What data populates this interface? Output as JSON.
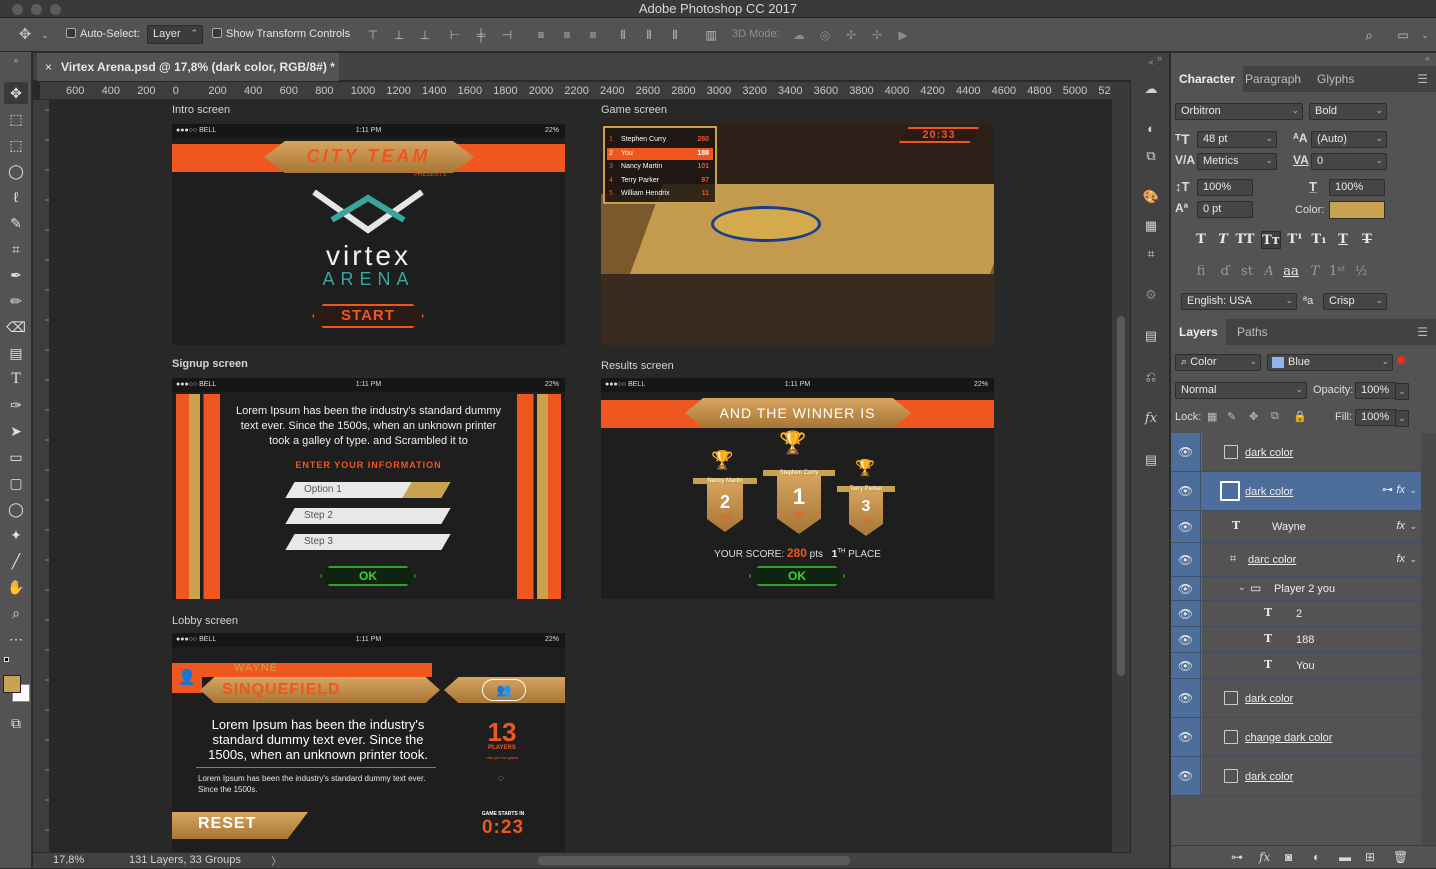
{
  "app": {
    "title": "Adobe Photoshop CC 2017"
  },
  "options": {
    "auto_select_label": "Auto-Select:",
    "auto_select_value": "Layer",
    "transform_controls_label": "Show Transform Controls",
    "mode_3d_label": "3D Mode:"
  },
  "document": {
    "tab_title": "Virtex Arena.psd @ 17,8% (dark color, RGB/8#) *",
    "ruler_ticks": [
      "600",
      "400",
      "200",
      "0",
      "200",
      "400",
      "600",
      "800",
      "1000",
      "1200",
      "1400",
      "1600",
      "1800",
      "2000",
      "2200",
      "2400",
      "2600",
      "2800",
      "3000",
      "3200",
      "3400",
      "3600",
      "3800",
      "4000",
      "4200",
      "4400",
      "4600",
      "4800",
      "5000",
      "52"
    ],
    "zoom": "17,8%",
    "info": "131 Layers, 33 Groups"
  },
  "artboards": {
    "intro": {
      "label": "Intro screen",
      "status_carrier": "●●●○○ BELL",
      "status_time": "1:11 PM",
      "status_battery": "22%",
      "banner": "CITY TEAM",
      "presents": "PRESENTS",
      "logo_line1": "virtex",
      "logo_line2": "ARENA",
      "start": "START"
    },
    "game": {
      "label": "Game screen",
      "timer": "20:33",
      "leaderboard": [
        {
          "rank": "1",
          "name": "Stephen Curry",
          "score": "280"
        },
        {
          "rank": "2",
          "name": "You",
          "score": "188"
        },
        {
          "rank": "3",
          "name": "Nancy Martin",
          "score": "101"
        },
        {
          "rank": "4",
          "name": "Terry Parker",
          "score": "97"
        },
        {
          "rank": "5",
          "name": "William Hendrix",
          "score": "11"
        }
      ]
    },
    "signup": {
      "label": "Signup screen",
      "status_carrier": "●●●○○ BELL",
      "status_time": "1:11 PM",
      "status_battery": "22%",
      "body": "Lorem Ipsum has been the industry's standard dummy text ever. Since the 1500s, when an unknown printer took a galley of type. and Scrambled it to",
      "heading": "ENTER YOUR INFORMATION",
      "option1": "Option 1",
      "step2": "Step 2",
      "step3": "Step 3",
      "ok": "OK"
    },
    "results": {
      "label": "Results screen",
      "status_carrier": "●●●○○ BELL",
      "status_time": "1:11 PM",
      "status_battery": "22%",
      "banner": "AND THE WINNER IS",
      "p1_name": "Nancy Martin",
      "p1_rank": "2",
      "p1_score": "101",
      "p2_name": "Stephen Curry",
      "p2_rank": "1",
      "p2_score": "280",
      "p3_name": "Terry Parker",
      "p3_rank": "3",
      "p3_score": "97",
      "score_prefix": "YOUR SCORE:",
      "score_value": "280",
      "score_suffix": "pts",
      "place_num": "1",
      "place_sup": "TH",
      "place_word": "PLACE",
      "ok": "OK"
    },
    "lobby": {
      "label": "Lobby screen",
      "status_carrier": "●●●○○ BELL",
      "status_time": "1:11 PM",
      "status_battery": "22%",
      "first_name": "WAYNE",
      "last_name": "SINQUEFIELD",
      "body_large": "Lorem Ipsum has been the industry's standard dummy text ever. Since the 1500s, when an unknown printer took.",
      "body_small": "Lorem Ipsum has been the industry's standard dummy text ever. Since the 1500s.",
      "players_count": "13",
      "players_label": "PLAYERS",
      "players_sub": "Has join the game",
      "starts_label": "GAME STARTS IN",
      "countdown": "0:23",
      "reset": "RESET"
    }
  },
  "character": {
    "tabs": [
      "Character",
      "Paragraph",
      "Glyphs"
    ],
    "font_family": "Orbitron",
    "font_style": "Bold",
    "size": "48 pt",
    "leading": "(Auto)",
    "kerning": "Metrics",
    "tracking": "0",
    "vscale": "100%",
    "hscale": "100%",
    "baseline": "0 pt",
    "color_label": "Color:",
    "color_hex": "#c8a24e",
    "language": "English: USA",
    "aa_label": "ªa",
    "antialias": "Crisp"
  },
  "layers": {
    "tabs": [
      "Layers",
      "Paths"
    ],
    "filter_kind": "Color",
    "filter_value": "Blue",
    "blend_mode": "Normal",
    "opacity_label": "Opacity:",
    "opacity": "100%",
    "lock_label": "Lock:",
    "fill_label": "Fill:",
    "fill": "100%",
    "items": [
      {
        "name": "dark color",
        "type": "smart"
      },
      {
        "name": "dark color",
        "type": "smart"
      },
      {
        "name": "Wayne",
        "type": "text"
      },
      {
        "name": "darc color",
        "type": "smart"
      },
      {
        "name": "Player 2 you",
        "type": "group"
      },
      {
        "name": "2",
        "type": "text"
      },
      {
        "name": "188",
        "type": "text"
      },
      {
        "name": "You",
        "type": "text"
      },
      {
        "name": "dark color",
        "type": "smart"
      },
      {
        "name": "change dark color",
        "type": "smart"
      },
      {
        "name": "dark color",
        "type": "smart"
      }
    ]
  }
}
